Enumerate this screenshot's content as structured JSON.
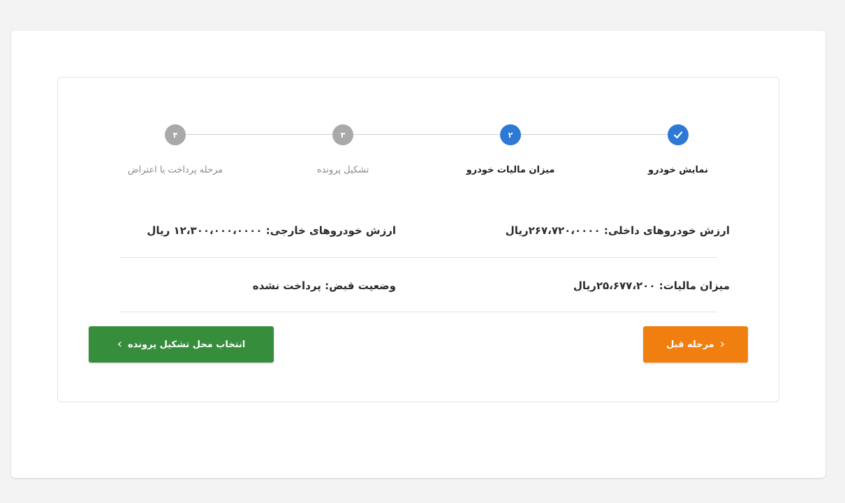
{
  "stepper": {
    "steps": [
      {
        "number": "",
        "label": "نمایش خودرو",
        "state": "done"
      },
      {
        "number": "۲",
        "label": "میزان مالیات خودرو",
        "state": "active"
      },
      {
        "number": "۳",
        "label": "تشکیل پرونده",
        "state": "pending"
      },
      {
        "number": "۴",
        "label": "مرحله پرداخت یا اعتراض",
        "state": "pending"
      }
    ]
  },
  "info": {
    "domestic_value": "ارزش خودروهای داخلی: ۲۶۷،۷۲۰،۰۰۰۰ریال",
    "foreign_value": "ارزش خودروهای خارجی: ۱۲،۳۰۰،۰۰۰،۰۰۰۰ ریال",
    "tax_amount": "میزان مالیات: ۲۵،۶۷۷،۲۰۰ریال",
    "receipt_status": "وضعیت قبض: پرداخت نشده"
  },
  "buttons": {
    "prev_label": "مرحله قبل",
    "next_label": "انتخاب محل تشکیل پرونده"
  },
  "colors": {
    "primary": "#2e79d6",
    "pending": "#a9a9a9",
    "prev_button": "#f07f0f",
    "next_button": "#368e3c"
  },
  "icons": {
    "done_step": "check-icon",
    "prev_chevron": "chevron-left-icon",
    "next_chevron": "chevron-right-icon"
  }
}
